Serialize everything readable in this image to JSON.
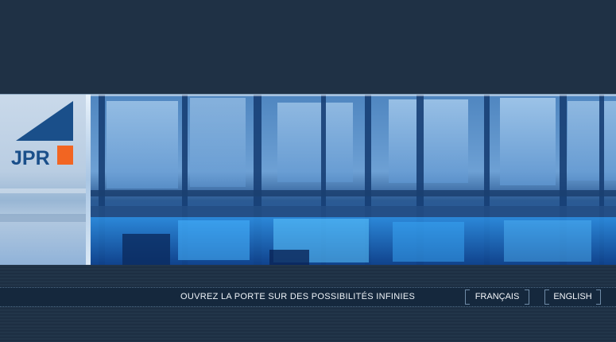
{
  "logo": {
    "text": "JPR",
    "colors": {
      "blue": "#1a4f8a",
      "orange": "#f26522"
    }
  },
  "tagline": "OUVREZ LA PORTE SUR DES POSSIBILITÉS INFINIES",
  "languages": {
    "french": "FRANÇAIS",
    "english": "ENGLISH"
  },
  "colors": {
    "background": "#1e3044",
    "bar": "#15283d",
    "text": "#eef3f8"
  }
}
